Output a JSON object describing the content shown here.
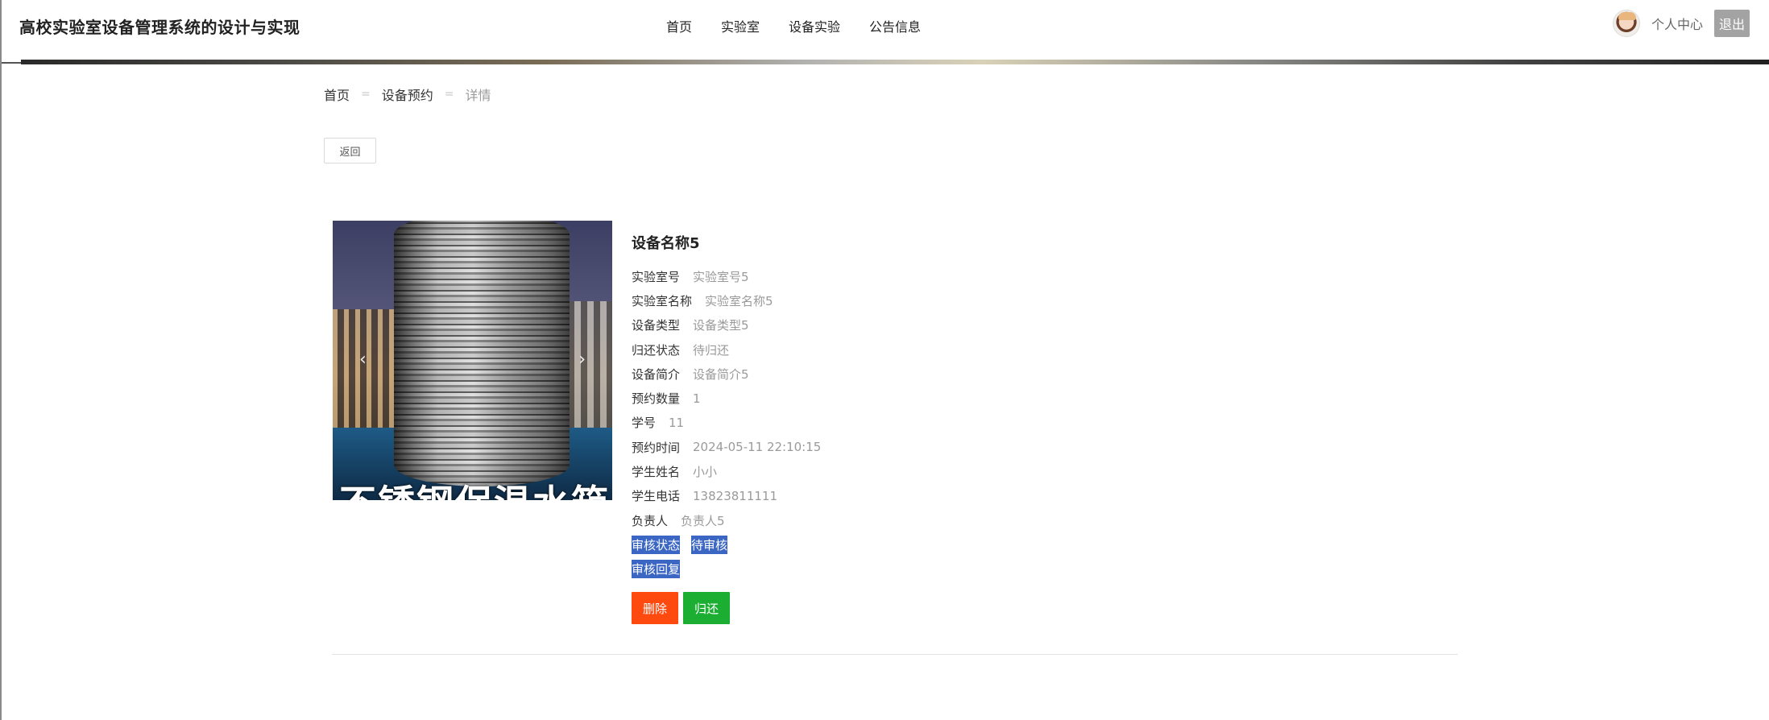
{
  "header": {
    "site_title": "高校实验室设备管理系统的设计与实现",
    "nav": [
      {
        "label": "首页"
      },
      {
        "label": "实验室"
      },
      {
        "label": "设备实验"
      },
      {
        "label": "公告信息"
      }
    ],
    "user_center_label": "个人中心",
    "logout_label": "退出"
  },
  "breadcrumb": {
    "items": [
      "首页",
      "设备预约"
    ],
    "current": "详情",
    "separator": "="
  },
  "back_button_label": "返回",
  "carousel": {
    "overlay_text": "不锈钢保温水箱",
    "prev_icon": "‹",
    "next_icon": "›"
  },
  "detail": {
    "title": "设备名称5",
    "fields": [
      {
        "label": "实验室号",
        "value": "实验室号5"
      },
      {
        "label": "实验室名称",
        "value": "实验室名称5"
      },
      {
        "label": "设备类型",
        "value": "设备类型5"
      },
      {
        "label": "归还状态",
        "value": "待归还"
      },
      {
        "label": "设备简介",
        "value": "设备简介5"
      },
      {
        "label": "预约数量",
        "value": "1"
      },
      {
        "label": "学号",
        "value": "11"
      },
      {
        "label": "预约时间",
        "value": "2024-05-11 22:10:15"
      },
      {
        "label": "学生姓名",
        "value": "小小"
      },
      {
        "label": "学生电话",
        "value": "13823811111"
      },
      {
        "label": "负责人",
        "value": "负责人5"
      },
      {
        "label": "审核状态",
        "value": "待审核"
      },
      {
        "label": "审核回复",
        "value": ""
      }
    ]
  },
  "actions": {
    "delete_label": "删除",
    "return_label": "归还"
  },
  "colors": {
    "highlight": "#3b66c4",
    "delete": "#ff4a0f",
    "return": "#1cae32",
    "logout": "#a3a3a3"
  }
}
